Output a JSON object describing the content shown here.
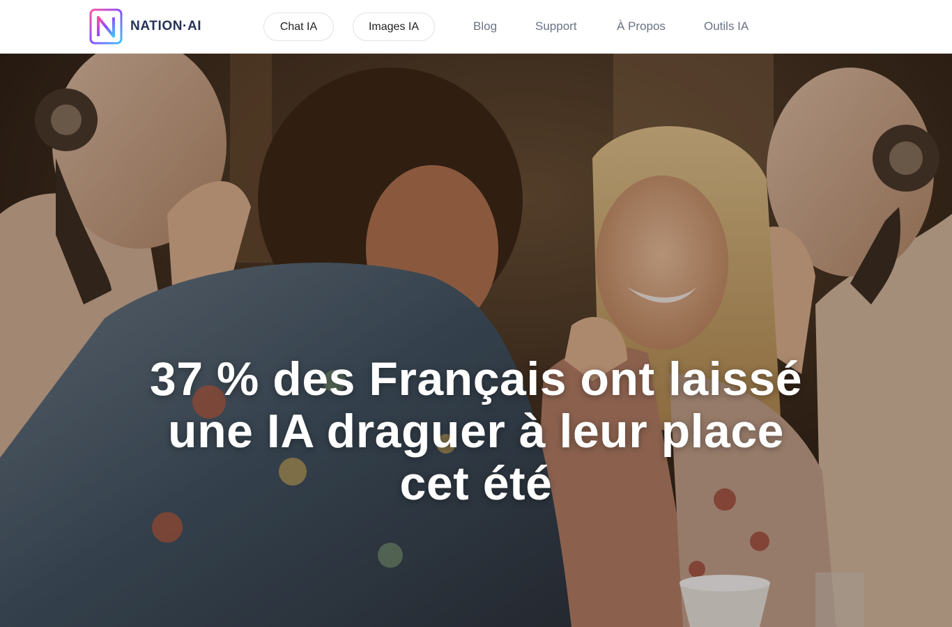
{
  "brand": {
    "name": "NATION·AI",
    "logo_letter": "N",
    "colors": {
      "text": "#25325a",
      "gradient_start": "#ff4fa0",
      "gradient_mid": "#8a4dff",
      "gradient_end": "#3ec5ff"
    }
  },
  "nav": {
    "pill_buttons": [
      {
        "label": "Chat IA"
      },
      {
        "label": "Images IA"
      }
    ],
    "links": [
      {
        "label": "Blog"
      },
      {
        "label": "Support"
      },
      {
        "label": "À Propos"
      },
      {
        "label": "Outils IA"
      }
    ]
  },
  "hero": {
    "title": "37 % des Français ont laissé une IA draguer à leur place cet été",
    "image_subject": "cafe-couple-with-whispering-robots-photo",
    "overlay_color": "#140c06"
  }
}
